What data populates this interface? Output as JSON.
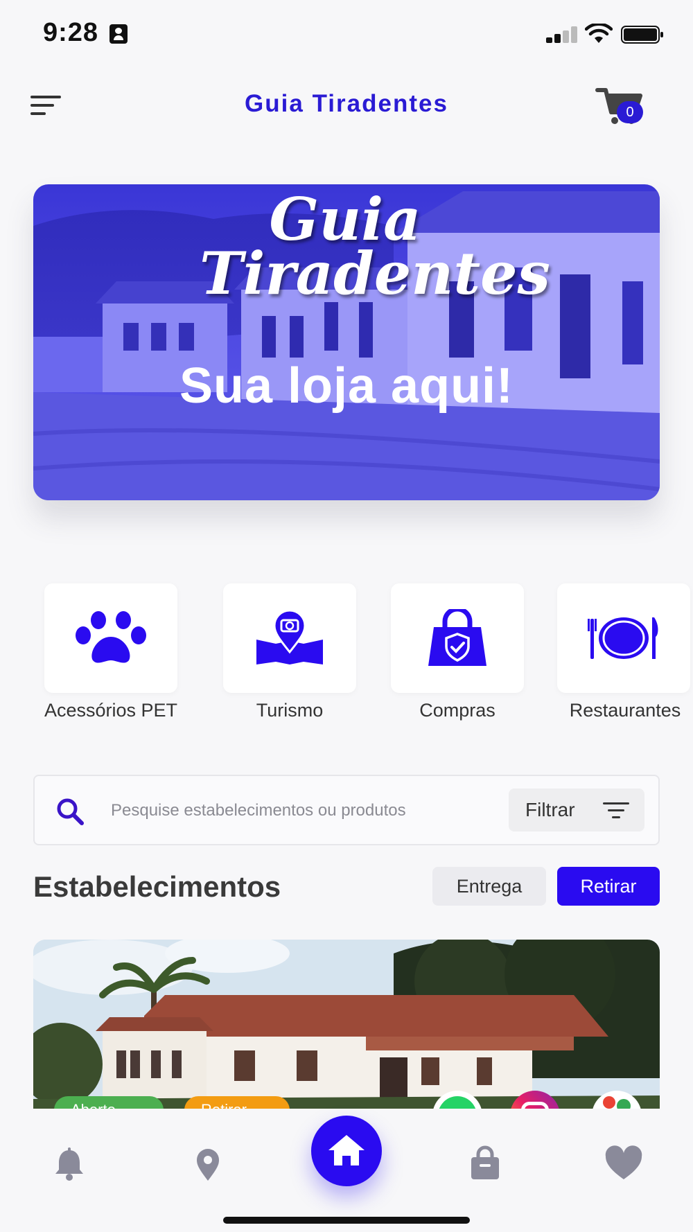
{
  "status_bar": {
    "time": "9:28"
  },
  "header": {
    "title": "Guia Tiradentes",
    "cart_count": "0"
  },
  "banner": {
    "script_text": "Guia Tiradentes",
    "headline": "Sua loja aqui!"
  },
  "categories": [
    {
      "label": "Acessórios PET",
      "icon": "paw-icon"
    },
    {
      "label": "Turismo",
      "icon": "map-pin-camera-icon"
    },
    {
      "label": "Compras",
      "icon": "shopping-bag-icon"
    },
    {
      "label": "Restaurantes",
      "icon": "plate-cutlery-icon"
    }
  ],
  "search": {
    "placeholder": "Pesquise estabelecimentos ou produtos",
    "filter_label": "Filtrar"
  },
  "establishments": {
    "title": "Estabelecimentos",
    "mode_delivery": "Entrega",
    "mode_pickup": "Retirar",
    "selected_mode": "Retirar",
    "card": {
      "status_badge": "Aberto",
      "pickup_badge": "Retirar",
      "social_icons": [
        "whatsapp-icon",
        "instagram-icon",
        "google-maps-icon"
      ]
    }
  },
  "bottom_nav": {
    "items": [
      "bell-icon",
      "location-pin-icon",
      "home-icon",
      "shopping-bag-icon",
      "heart-icon"
    ],
    "active": "home-icon"
  },
  "colors": {
    "accent": "#2a0bf0",
    "title": "#2a1bd4",
    "background": "#f7f7f9",
    "open_green": "#4caf50",
    "pickup_orange": "#f39c12"
  }
}
